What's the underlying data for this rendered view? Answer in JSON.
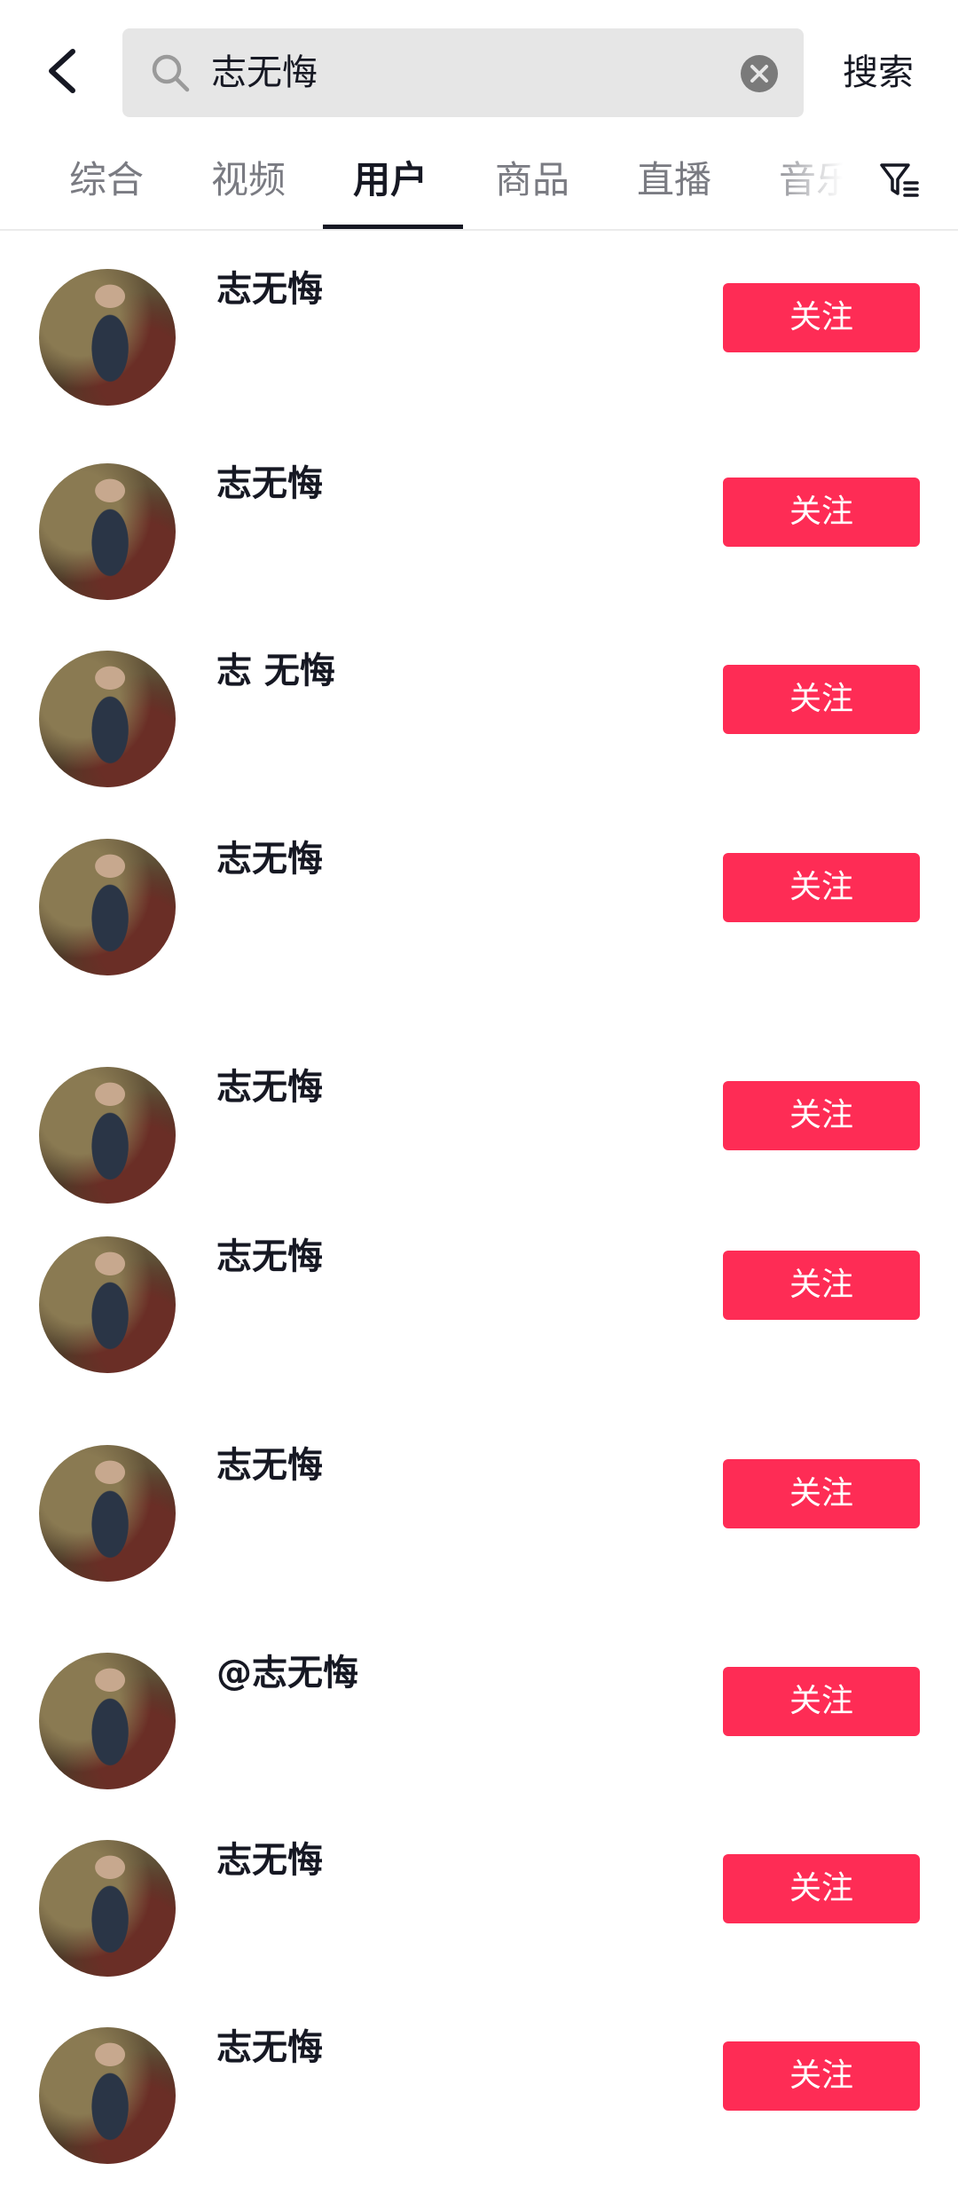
{
  "search": {
    "query": "志无悔",
    "button_label": "搜索"
  },
  "tabs": [
    "综合",
    "视频",
    "用户",
    "商品",
    "直播",
    "音乐"
  ],
  "active_tab": "用户",
  "results": [
    {
      "nickname": "志无悔",
      "follow_label": "关注"
    },
    {
      "nickname": "志无悔",
      "follow_label": "关注"
    },
    {
      "nickname": "志 无悔",
      "follow_label": "关注"
    },
    {
      "nickname": "志无悔",
      "follow_label": "关注"
    },
    {
      "nickname": "志无悔",
      "follow_label": "关注"
    },
    {
      "nickname": "志无悔",
      "follow_label": "关注"
    },
    {
      "nickname": "志无悔",
      "follow_label": "关注"
    },
    {
      "nickname": "@志无悔",
      "follow_label": "关注"
    },
    {
      "nickname": "志无悔",
      "follow_label": "关注"
    },
    {
      "nickname": "志无悔",
      "follow_label": "关注"
    }
  ],
  "colors": {
    "accent": "#fe2c55",
    "text": "#161823",
    "muted": "#7a7b82",
    "search_bg": "#e6e6e6"
  },
  "icons": [
    "back-arrow-icon",
    "search-icon",
    "clear-icon",
    "filter-icon"
  ]
}
